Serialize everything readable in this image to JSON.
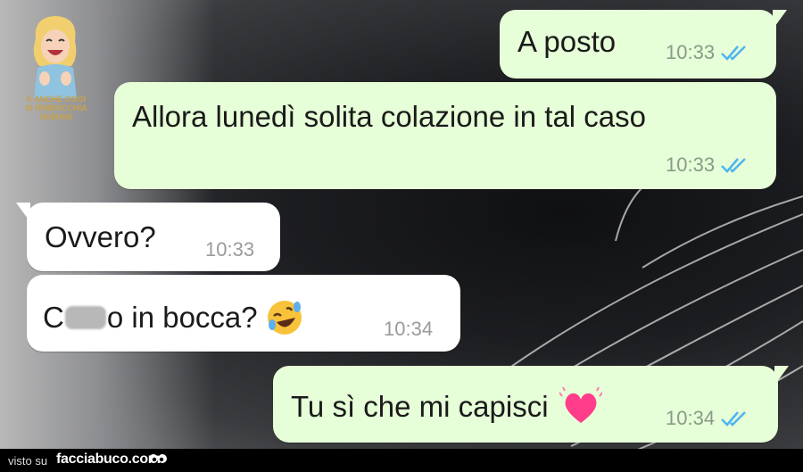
{
  "watermark": {
    "caption_line1": "E ANCHE OGGI",
    "caption_line2": "SI RIMBOCCHIA DOMANI"
  },
  "messages": [
    {
      "direction": "outgoing",
      "text": "A posto",
      "time": "10:33",
      "status": "read"
    },
    {
      "direction": "outgoing",
      "text": "Allora lunedì solita colazione in tal caso",
      "time": "10:33",
      "status": "read"
    },
    {
      "direction": "incoming",
      "text": "Ovvero?",
      "time": "10:33"
    },
    {
      "direction": "incoming",
      "text_start": "C",
      "text_end": "o in bocca?",
      "emoji": "rolling-on-floor-laughing",
      "time": "10:34"
    },
    {
      "direction": "outgoing",
      "text": "Tu sì che mi capisci",
      "emoji": "beating-heart",
      "time": "10:34",
      "status": "read"
    }
  ],
  "footer": {
    "visto_label": "visto su",
    "brand": "facciabuco.com"
  },
  "colors": {
    "outgoing_bubble": "#e6ffd8",
    "incoming_bubble": "#ffffff",
    "read_ticks": "#4fb4f0",
    "footer_bg": "#000000"
  }
}
